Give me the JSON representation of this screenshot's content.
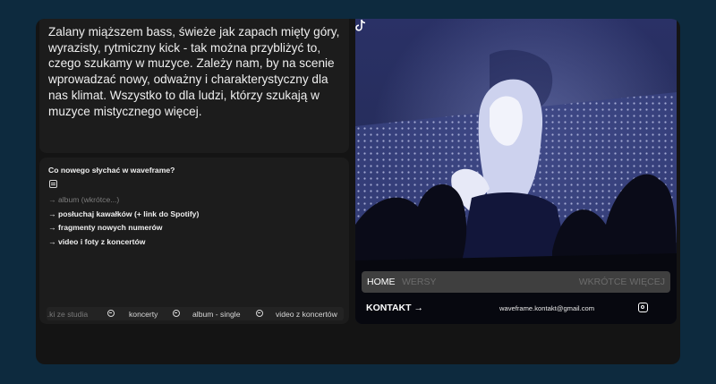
{
  "intro": {
    "text": "Zalany miąższem bass, świeże jak zapach mięty góry, wyrazisty, rytmiczny kick - tak można przybliżyć to, czego szukamy w muzyce. Zależy nam, by na scenie wprowadzać nowy, odważny i charakterystyczny dla nas klimat. Wszystko to dla ludzi, którzy szukają w muzyce mistycznego więcej."
  },
  "news": {
    "title": "Co nowego słychać w waveframe?",
    "icon": "calendar-icon",
    "items": [
      "→ album (wkrótce...)",
      "→ posłuchaj kawałków (+ link do Spotify)",
      "→ fragmenty nowych numerów",
      "→ video i foty z koncertów"
    ]
  },
  "tags": [
    "...ki ze studia",
    "koncerty",
    "album - single",
    "video z koncertów"
  ],
  "nav": {
    "home": "HOME",
    "wersy": "WERSY",
    "soon": "WKRÓTCE WIĘCEJ"
  },
  "footer": {
    "contact": "KONTAKT →",
    "email": "waveframe.kontakt@gmail.com",
    "icons": [
      "instagram-icon",
      "tiktok-icon"
    ]
  },
  "colors": {
    "page_bg": "#0d2a3e",
    "panel_bg": "#1c1c1c",
    "nav_bg": "#3f3f3f"
  }
}
